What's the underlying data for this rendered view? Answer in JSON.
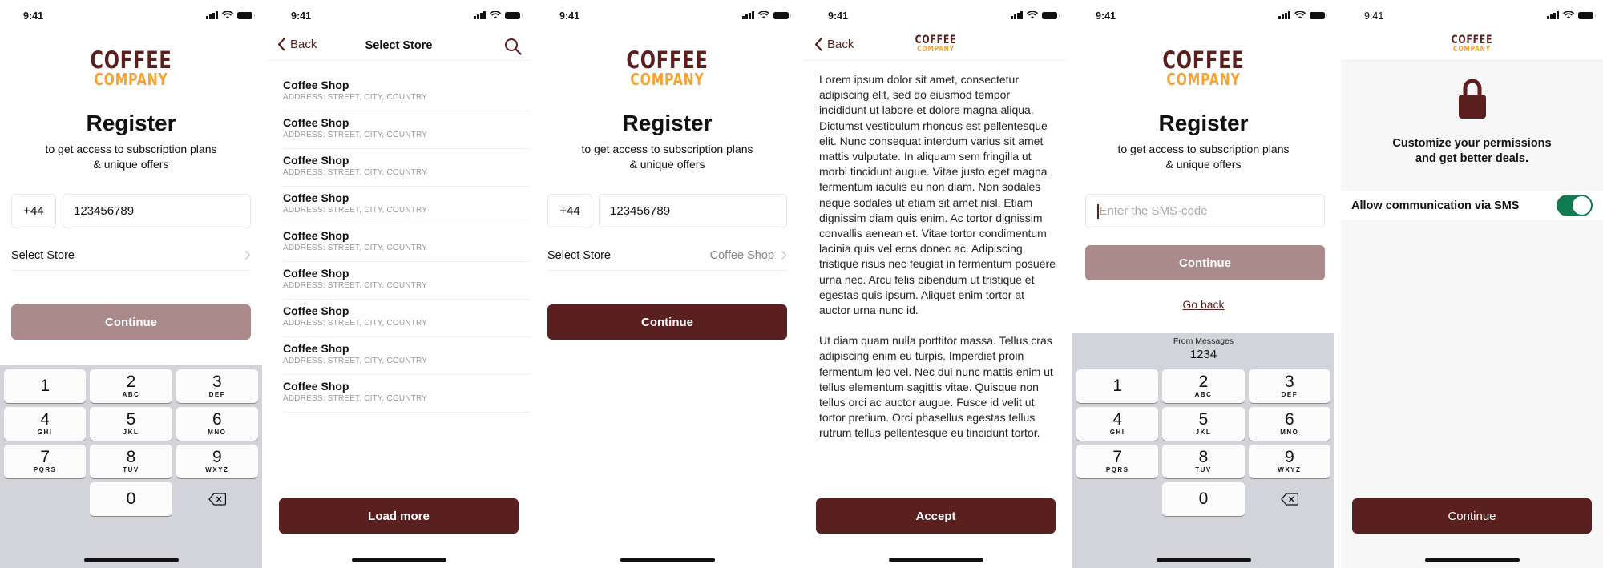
{
  "status_bar": {
    "time": "9:41"
  },
  "brand": {
    "line1": "COFFEE",
    "line2": "COMPANY",
    "primary_color": "#5a1f1f",
    "accent_color": "#f7a231",
    "disabled_color": "#aa8a8a",
    "toggle_color": "#147a4f"
  },
  "register": {
    "title": "Register",
    "subtitle_line1": "to get access to subscription plans",
    "subtitle_line2": "& unique offers",
    "country_code": "+44",
    "phone_number": "123456789",
    "select_store_label": "Select Store",
    "continue_label": "Continue"
  },
  "register_filled": {
    "title": "Register",
    "subtitle_line1": "to get access to subscription plans",
    "subtitle_line2": "& unique offers",
    "country_code": "+44",
    "phone_number": "123456789",
    "select_store_label": "Select Store",
    "selected_store": "Coffee Shop",
    "continue_label": "Continue"
  },
  "keyboard": {
    "keys": [
      {
        "num": "1",
        "letters": ""
      },
      {
        "num": "2",
        "letters": "ABC"
      },
      {
        "num": "3",
        "letters": "DEF"
      },
      {
        "num": "4",
        "letters": "GHI"
      },
      {
        "num": "5",
        "letters": "JKL"
      },
      {
        "num": "6",
        "letters": "MNO"
      },
      {
        "num": "7",
        "letters": "PQRS"
      },
      {
        "num": "8",
        "letters": "TUV"
      },
      {
        "num": "9",
        "letters": "WXYZ"
      },
      {
        "num": "0",
        "letters": ""
      }
    ]
  },
  "store_select": {
    "back_label": "Back",
    "title": "Select Store",
    "stores": [
      {
        "name": "Coffee Shop",
        "address": "ADDRESS: STREET, CITY, COUNTRY"
      },
      {
        "name": "Coffee Shop",
        "address": "ADDRESS: STREET, CITY, COUNTRY"
      },
      {
        "name": "Coffee Shop",
        "address": "ADDRESS: STREET, CITY, COUNTRY"
      },
      {
        "name": "Coffee Shop",
        "address": "ADDRESS: STREET, CITY, COUNTRY"
      },
      {
        "name": "Coffee Shop",
        "address": "ADDRESS: STREET, CITY, COUNTRY"
      },
      {
        "name": "Coffee Shop",
        "address": "ADDRESS: STREET, CITY, COUNTRY"
      },
      {
        "name": "Coffee Shop",
        "address": "ADDRESS: STREET, CITY, COUNTRY"
      },
      {
        "name": "Coffee Shop",
        "address": "ADDRESS: STREET, CITY, COUNTRY"
      },
      {
        "name": "Coffee Shop",
        "address": "ADDRESS: STREET, CITY, COUNTRY"
      }
    ],
    "load_more_label": "Load more"
  },
  "terms": {
    "back_label": "Back",
    "paragraph1": "Lorem ipsum dolor sit amet, consectetur adipiscing elit, sed do eiusmod tempor incididunt ut labore et dolore magna aliqua. Dictumst vestibulum rhoncus est pellentesque elit. Nunc consequat interdum varius sit amet mattis vulputate. In aliquam sem fringilla ut morbi tincidunt augue. Vitae justo eget magna fermentum iaculis eu non diam. Non sodales neque sodales ut etiam sit amet nisl. Etiam dignissim diam quis enim. Ac tortor dignissim convallis aenean et. Vitae tortor condimentum lacinia quis vel eros donec ac. Adipiscing tristique risus nec feugiat in fermentum posuere urna nec. Arcu felis bibendum ut tristique et egestas quis ipsum. Aliquet enim tortor at auctor urna nunc id.",
    "paragraph2": "Ut diam quam nulla porttitor massa. Tellus cras adipiscing enim eu turpis. Imperdiet proin fermentum leo vel. Nec dui nunc mattis enim ut tellus elementum sagittis vitae. Quisque non tellus orci ac auctor augue. Fusce id velit ut tortor pretium. Orci phasellus egestas tellus rutrum tellus pellentesque eu tincidunt tortor.",
    "accept_label": "Accept"
  },
  "sms": {
    "title": "Register",
    "subtitle_line1": "to get access to subscription plans",
    "subtitle_line2": "& unique offers",
    "code_value": "",
    "code_placeholder": "Enter the SMS-code",
    "continue_label": "Continue",
    "go_back_label": "Go back",
    "suggestion_source": "From Messages",
    "suggestion_code": "1234"
  },
  "permissions": {
    "heading_line1": "Customize your permissions",
    "heading_line2": "and get better deals.",
    "sms_toggle_label": "Allow communication via SMS",
    "sms_toggle_on": true,
    "continue_label": "Continue"
  }
}
